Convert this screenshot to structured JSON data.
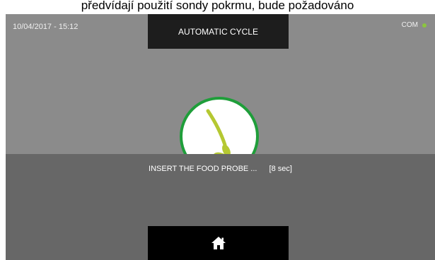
{
  "caption": "předvídají použití sondy pokrmu, bude požadováno",
  "status_bar": {
    "datetime": "10/04/2017 - 15:12",
    "com_label": "COM",
    "com_indicator_color": "#8bc53f"
  },
  "header": {
    "title": "AUTOMATIC CYCLE"
  },
  "overlay": {
    "message": "INSERT THE FOOD PROBE ...",
    "timer": "[8 sec]"
  },
  "icons": {
    "probe": "food-probe-icon",
    "home": "home-icon"
  },
  "colors": {
    "screen_background": "#8b8b8b",
    "overlay_background": "#676767",
    "accent_green": "#1f9e3a",
    "probe_yellow_green": "#b5c832"
  }
}
